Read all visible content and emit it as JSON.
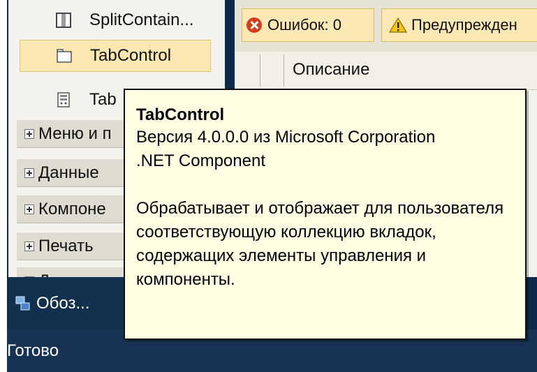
{
  "toolbox": {
    "items": [
      {
        "label": "SplitContain...",
        "icon": "split-container-icon"
      },
      {
        "label": "TabControl",
        "icon": "tab-control-icon",
        "selected": true
      },
      {
        "label": "Tab",
        "icon": "table-layout-icon"
      }
    ],
    "categories": [
      {
        "label": "Меню и п"
      },
      {
        "label": "Данные"
      },
      {
        "label": "Компоне"
      },
      {
        "label": "Печать"
      },
      {
        "label": "Диалого"
      }
    ]
  },
  "overview_tab": {
    "label": "Обоз...",
    "icon": "solution-explorer-icon"
  },
  "status_bar": {
    "text": "Готово"
  },
  "error_list": {
    "errors_button": "Ошибок: 0",
    "warnings_button": "Предупрежден",
    "column_header": "Описание"
  },
  "tooltip": {
    "title": "TabControl",
    "version": "Версия 4.0.0.0 из Microsoft Corporation",
    "component": ".NET Component",
    "description": "Обрабатывает и отображает для пользователя соответствующую коллекцию вкладок, содержащих элементы управления и компоненты."
  },
  "colors": {
    "selection": "#fae7b2",
    "tooltip_bg": "#ffffe3",
    "frame": "#0d2a4a",
    "error_icon": "#d43c1e",
    "warning_icon": "#f0c419"
  }
}
